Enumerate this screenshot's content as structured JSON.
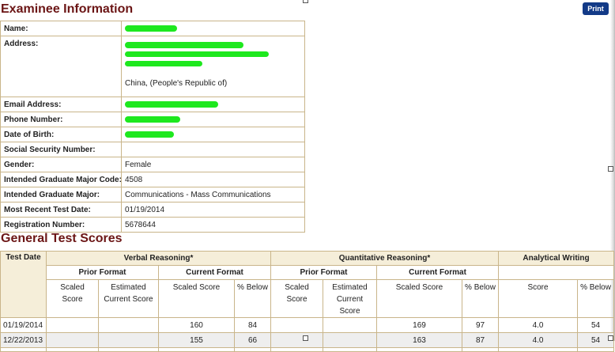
{
  "page": {
    "examinee_title": "Examinee Information",
    "scores_title": "General Test Scores",
    "print_label": "Print"
  },
  "examinee": {
    "name_label": "Name:",
    "address_label": "Address:",
    "address_country": "China, (People's Republic of)",
    "email_label": "Email Address:",
    "phone_label": "Phone Number:",
    "dob_label": "Date of Birth:",
    "ssn_label": "Social Security Number:",
    "ssn_value": "",
    "gender_label": "Gender:",
    "gender_value": "Female",
    "major_code_label": "Intended Graduate Major Code:",
    "major_code_value": "4508",
    "major_label": "Intended Graduate Major:",
    "major_value": "Communications - Mass Communications",
    "recent_date_label": "Most Recent Test Date:",
    "recent_date_value": "01/19/2014",
    "reg_label": "Registration Number:",
    "reg_value": "5678644"
  },
  "scores": {
    "headers": {
      "test_date": "Test Date",
      "verbal": "Verbal Reasoning*",
      "quant": "Quantitative Reasoning*",
      "writing": "Analytical Writing",
      "prior_format": "Prior Format",
      "current_format": "Current Format",
      "scaled_score": "Scaled Score",
      "estimated_current": "Estimated Current Score",
      "pct_below": "% Below",
      "score": "Score"
    },
    "rows": [
      {
        "date": "01/19/2014",
        "v_prior_scaled": "",
        "v_prior_est": "",
        "v_cur_scaled": "160",
        "v_cur_below": "84",
        "q_prior_scaled": "",
        "q_prior_est": "",
        "q_cur_scaled": "169",
        "q_cur_below": "97",
        "aw_score": "4.0",
        "aw_below": "54"
      },
      {
        "date": "12/22/2013",
        "v_prior_scaled": "",
        "v_prior_est": "",
        "v_cur_scaled": "155",
        "v_cur_below": "66",
        "q_prior_scaled": "",
        "q_prior_est": "",
        "q_cur_scaled": "163",
        "q_cur_below": "87",
        "aw_score": "4.0",
        "aw_below": "54"
      }
    ]
  },
  "colors": {
    "title": "#6b1515",
    "print_button": "#123a87",
    "border": "#c9b58a",
    "header_bg": "#f5eed9",
    "redaction": "#1ee81e"
  }
}
